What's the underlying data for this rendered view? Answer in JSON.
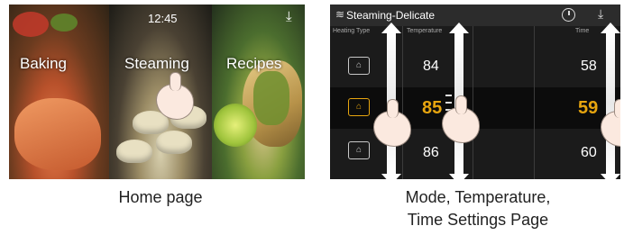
{
  "home": {
    "clock": "12:45",
    "tiles": [
      {
        "label": "Baking"
      },
      {
        "label": "Steaming"
      },
      {
        "label": "Recipes"
      }
    ],
    "caption": "Home page",
    "download_icon": "download-icon",
    "pager": {
      "count": 3,
      "active": 1
    }
  },
  "settings": {
    "mode_icon": "steam-icon",
    "title": "Steaming-Delicate",
    "header_icons": [
      "clock-icon",
      "download-icon"
    ],
    "columns": {
      "heating_type": "Heating Type",
      "temperature": "Temperature",
      "time": "Time"
    },
    "heating_types": [
      {
        "icon": "steam-low-icon",
        "selected": false
      },
      {
        "icon": "steam-medium-icon",
        "selected": true
      },
      {
        "icon": "steam-high-icon",
        "selected": false
      }
    ],
    "temperatures": [
      "84",
      "85",
      "86"
    ],
    "times": [
      "58",
      "59",
      "60"
    ],
    "selected_index": 1,
    "caption_line1": "Mode, Temperature,",
    "caption_line2": "Time Settings Page"
  },
  "colors": {
    "accent": "#e7a50f",
    "background": "#1b1b1b",
    "header": "#2c2c2c"
  }
}
